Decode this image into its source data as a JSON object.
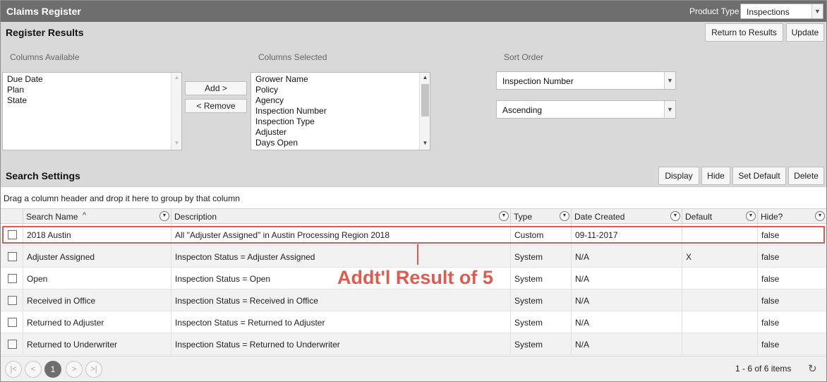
{
  "app": {
    "title": "Claims Register",
    "product_type_label": "Product Type",
    "product_type_value": "Inspections"
  },
  "register": {
    "title": "Register Results",
    "return_btn": "Return to Results",
    "update_btn": "Update",
    "columns_available_label": "Columns Available",
    "columns_selected_label": "Columns Selected",
    "sort_order_label": "Sort Order",
    "columns_available": [
      "Due Date",
      "Plan",
      "State"
    ],
    "columns_selected": [
      "Grower Name",
      "Policy",
      "Agency",
      "Inspection Number",
      "Inspection Type",
      "Adjuster",
      "Days Open"
    ],
    "add_btn": "Add >",
    "remove_btn": "< Remove",
    "sort_field": "Inspection Number",
    "sort_direction": "Ascending"
  },
  "search": {
    "title": "Search Settings",
    "display_btn": "Display",
    "hide_btn": "Hide",
    "set_default_btn": "Set Default",
    "delete_btn": "Delete",
    "group_hint": "Drag a column header and drop it here to group by that column",
    "columns": [
      "Search Name",
      "Description",
      "Type",
      "Date Created",
      "Default",
      "Hide?"
    ],
    "rows": [
      {
        "name": "2018 Austin",
        "description": "All \"Adjuster Assigned\" in Austin Processing Region 2018",
        "type": "Custom",
        "date": "09-11-2017",
        "default": "",
        "hide": "false"
      },
      {
        "name": "Adjuster Assigned",
        "description": "Inspecton Status = Adjuster Assigned",
        "type": "System",
        "date": "N/A",
        "default": "X",
        "hide": "false"
      },
      {
        "name": "Open",
        "description": "Inspection Status = Open",
        "type": "System",
        "date": "N/A",
        "default": "",
        "hide": "false"
      },
      {
        "name": "Received in Office",
        "description": "Inspection Status = Received in Office",
        "type": "System",
        "date": "N/A",
        "default": "",
        "hide": "false"
      },
      {
        "name": "Returned to Adjuster",
        "description": "Inspecton Status = Returned to Adjuster",
        "type": "System",
        "date": "N/A",
        "default": "",
        "hide": "false"
      },
      {
        "name": "Returned to Underwriter",
        "description": "Inspection Status = Returned to Underwriter",
        "type": "System",
        "date": "N/A",
        "default": "",
        "hide": "false"
      }
    ],
    "annotation": "Addt'l Result of 5",
    "pager": {
      "current_page": "1",
      "info": "1 - 6 of 6 items"
    }
  },
  "colors": {
    "header_bg": "#6e6e6e",
    "panel_bg": "#d9d9d9",
    "annotation": "#e05a50"
  }
}
